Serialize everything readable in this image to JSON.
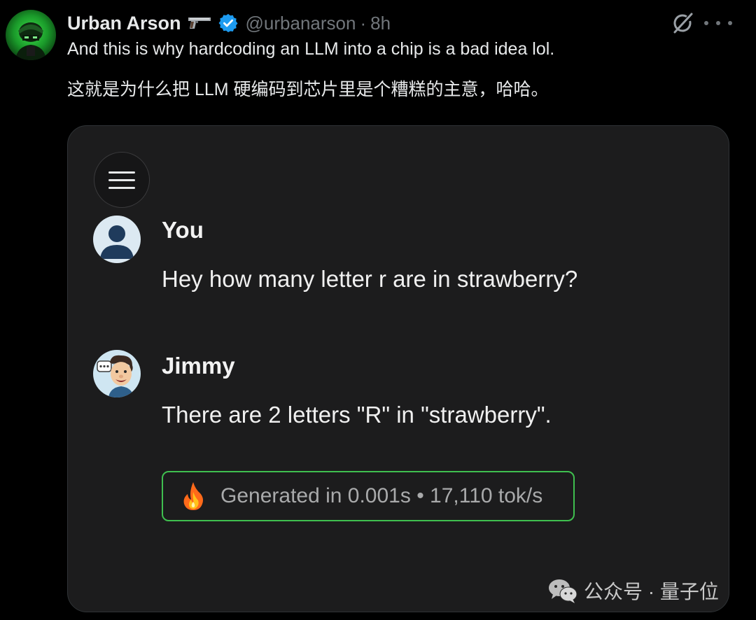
{
  "post": {
    "author": {
      "display_name": "Urban Arson",
      "handle": "@urbanarson",
      "time": "8h",
      "separator": "·",
      "verified": true,
      "name_emoji": "pistol-icon"
    },
    "text_en": "And this is why hardcoding an LLM into a chip is a bad idea lol.",
    "text_zh": "这就是为什么把 LLM 硬编码到芯片里是个糟糕的主意，哈哈。",
    "actions": [
      "grok-icon",
      "more-icon"
    ],
    "colors": {
      "background": "#000000",
      "text": "#e7e9ea",
      "muted": "#71767b",
      "verified": "#1d9bf0"
    }
  },
  "chat_screenshot": {
    "menu_icon": "hamburger-menu-icon",
    "messages": [
      {
        "sender": "You",
        "avatar": "user-silhouette-avatar",
        "text": "Hey how many letter r are in strawberry?"
      },
      {
        "sender": "Jimmy",
        "avatar": "cartoon-man-avatar",
        "text": "There are 2 letters \"R\" in \"strawberry\"."
      }
    ],
    "stats": {
      "icon": "fire-icon",
      "text": "Generated in 0.001s • 17,110 tok/s",
      "border_color": "#3fbf4f"
    }
  },
  "watermark": {
    "icon": "wechat-icon",
    "text": "公众号 · 量子位"
  }
}
